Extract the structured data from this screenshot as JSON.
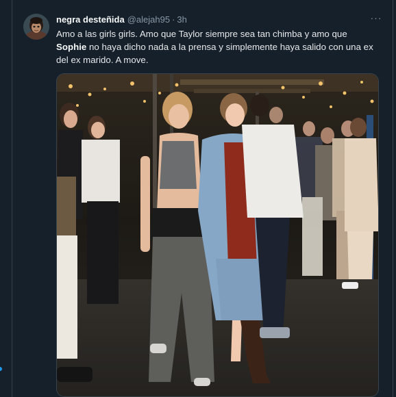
{
  "tweet": {
    "display_name": "negra desteñida",
    "handle": "@alejah95",
    "separator": "·",
    "time": "3h",
    "more_label": "···",
    "text_part1": "Amo a las girls girls. Amo que Taylor siempre sea tan chimba y amo que",
    "text_bold": "Sophie",
    "text_part2": " no haya dicho nada a la prensa y simplemente haya salido con una ex del ex marido. A move."
  },
  "media": {
    "description_icon": "photo"
  },
  "colors": {
    "background": "#15202b",
    "border": "#38444d",
    "text_primary": "#e7e9ea",
    "text_secondary": "#8b98a5",
    "accent": "#1d9bf0"
  }
}
